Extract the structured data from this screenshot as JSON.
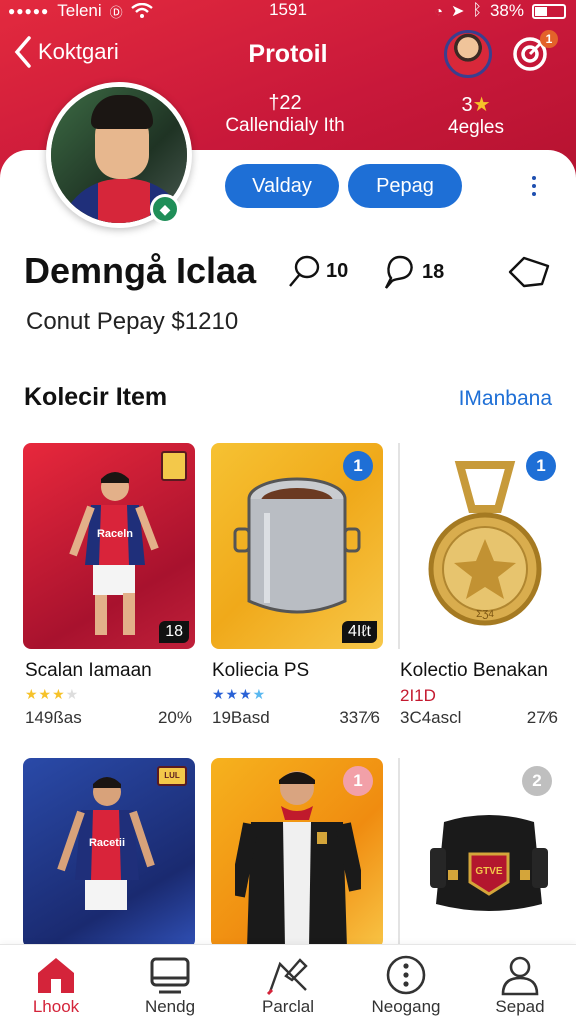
{
  "status_bar": {
    "carrier": "Teleni",
    "time": "1591",
    "battery": "38%"
  },
  "header": {
    "back_label": "Koktgari",
    "title": "Protoil",
    "notif_count": "1"
  },
  "stats": [
    {
      "value": "†22",
      "label": "Callendialy Ith"
    },
    {
      "value": "3",
      "label": "4egles"
    }
  ],
  "actions": {
    "primary": "Valday",
    "secondary": "Pepag"
  },
  "profile": {
    "name": "Demngå Iclaa",
    "likes": "10",
    "comments": "18",
    "count_text": "Conut Pepay $1210"
  },
  "collection": {
    "title": "Kolecir Item",
    "see_all": "IManbana",
    "items": [
      {
        "title": "Scalan Iamaan",
        "stars": 3,
        "meta": "149ßas",
        "pct": "20%",
        "badge": "",
        "corner": "18",
        "jersey": "Raceln"
      },
      {
        "title": "Koliecia PS",
        "stars": 4,
        "meta": "19Basd",
        "pct": "337⁄6",
        "badge": "1",
        "corner": "4Iℓt"
      },
      {
        "title": "Kolectio Benakan",
        "subtitle": "2I1D",
        "meta": "3C4ascl",
        "pct": "27⁄6",
        "badge": "1",
        "medal_text": "ΣƷ4"
      },
      {
        "title": "",
        "badge": "",
        "jersey": "Racetii",
        "crest": "LUL"
      },
      {
        "title": "",
        "badge": "1"
      },
      {
        "title": "",
        "badge": "2",
        "crest": "GTVE"
      }
    ]
  },
  "tabbar": [
    {
      "label": "Lhook",
      "icon": "home-icon",
      "active": true
    },
    {
      "label": "Nendg",
      "icon": "monitor-icon",
      "active": false
    },
    {
      "label": "Parclal",
      "icon": "pencil-icon",
      "active": false
    },
    {
      "label": "Neogang",
      "icon": "more-circle-icon",
      "active": false
    },
    {
      "label": "Sepad",
      "icon": "user-icon",
      "active": false
    }
  ],
  "colors": {
    "brand": "#d4243a",
    "accent": "#1e6fd6",
    "star": "#f6c22a",
    "star_blue": "#2a62d6"
  }
}
